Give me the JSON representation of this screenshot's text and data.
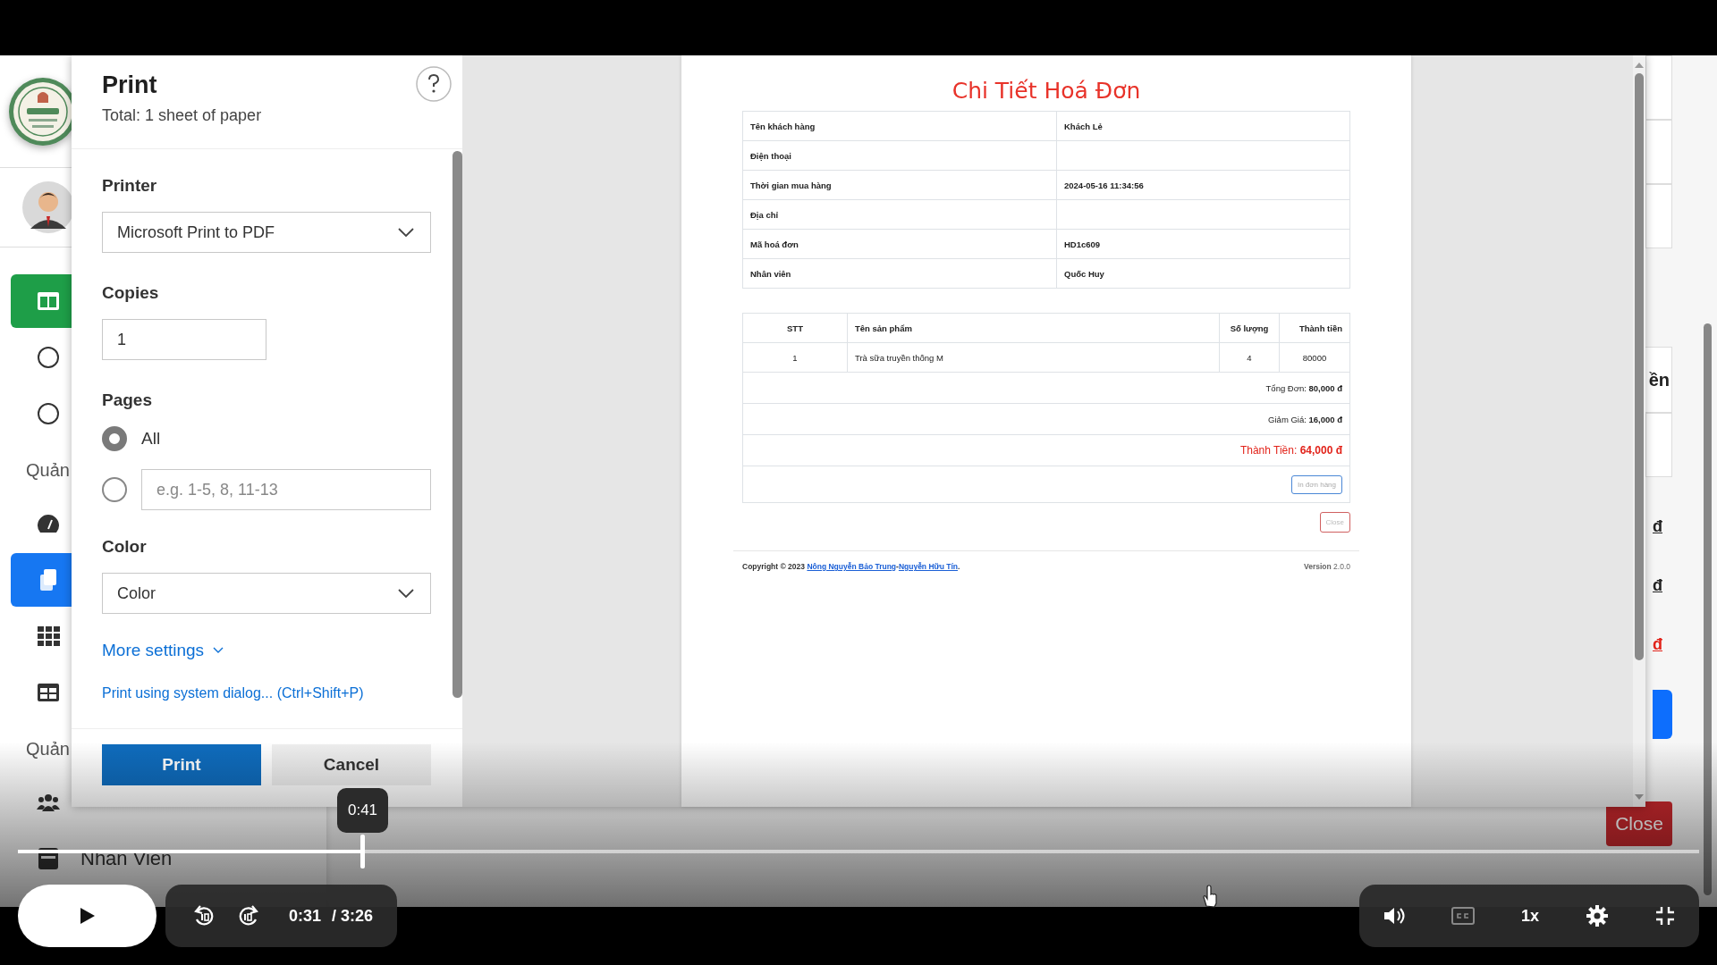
{
  "sidebar": {
    "items": [
      {
        "kind": "nav",
        "selected": true,
        "color": "#1e9e48"
      },
      {
        "kind": "nav",
        "selected": false
      },
      {
        "kind": "nav",
        "selected": false
      },
      {
        "kind": "heading",
        "label": "Quản"
      },
      {
        "kind": "nav",
        "selected": false
      },
      {
        "kind": "nav",
        "selected": true,
        "color": "#1677f2"
      },
      {
        "kind": "nav",
        "selected": false
      },
      {
        "kind": "nav",
        "selected": false
      },
      {
        "kind": "heading",
        "label": "Quản"
      },
      {
        "kind": "nav",
        "selected": false
      },
      {
        "kind": "nav",
        "selected": false,
        "label": "Nhân Viên"
      }
    ]
  },
  "background_page": {
    "heading_fragment": "ền",
    "amounts": [
      {
        "text": "đ",
        "kind": "normal"
      },
      {
        "text": "đ",
        "kind": "normal"
      },
      {
        "text": "đ",
        "kind": "total"
      }
    ],
    "close_button": "Close"
  },
  "print_dialog": {
    "title": "Print",
    "subtitle": "Total: 1 sheet of paper",
    "printer": {
      "label": "Printer",
      "value": "Microsoft Print to PDF"
    },
    "copies": {
      "label": "Copies",
      "value": "1"
    },
    "pages": {
      "label": "Pages",
      "options": [
        {
          "label": "All",
          "selected": true
        },
        {
          "placeholder": "e.g. 1-5, 8, 11-13",
          "selected": false
        }
      ]
    },
    "color": {
      "label": "Color",
      "value": "Color"
    },
    "more_settings": "More settings",
    "system_dialog_link": "Print using system dialog... (Ctrl+Shift+P)",
    "print_button": "Print",
    "cancel_button": "Cancel"
  },
  "invoice": {
    "title": "Chi Tiết Hoá Đơn",
    "details": [
      {
        "label": "Tên khách hàng",
        "value": "Khách Lẻ"
      },
      {
        "label": "Điện thoại"
      },
      {
        "label": "Thời gian mua hàng",
        "value": "2024-05-16 11:34:56"
      },
      {
        "label": "Địa chỉ"
      },
      {
        "label": "Mã hoá đơn",
        "value": "HD1c609"
      },
      {
        "label": "Nhân viên",
        "value": "Quốc Huy"
      }
    ],
    "items_table": {
      "columns": [
        "STT",
        "Tên sản phẩm",
        "Số lượng",
        "Thành tiền"
      ],
      "rows": [
        [
          "1",
          "Trà sữa truyền thống M",
          "4",
          "80000"
        ]
      ]
    },
    "summary": [
      {
        "text": "Tổng Đơn: **80,000 đ**",
        "kind": "normal"
      },
      {
        "text": "Giảm Giá: **16,000 đ**",
        "kind": "normal"
      },
      {
        "text": "Thành Tiền: **64,000 đ**",
        "kind": "total"
      }
    ],
    "print_order_button": "In đơn hàng",
    "close_button": "Close",
    "footer": {
      "copyright": "Copyright © 2023",
      "links": [
        "Nông Nguyễn Bảo Trung",
        "Nguyễn Hữu Tín"
      ],
      "separator": "-",
      "end": ".",
      "version": "**Version** 2.0.0"
    }
  },
  "video_player": {
    "playing": false,
    "progress": {
      "level": 0.205
    },
    "hover_time": "0:41",
    "current_time": "0:31",
    "duration": "/ 3:26",
    "speed": "1x"
  }
}
